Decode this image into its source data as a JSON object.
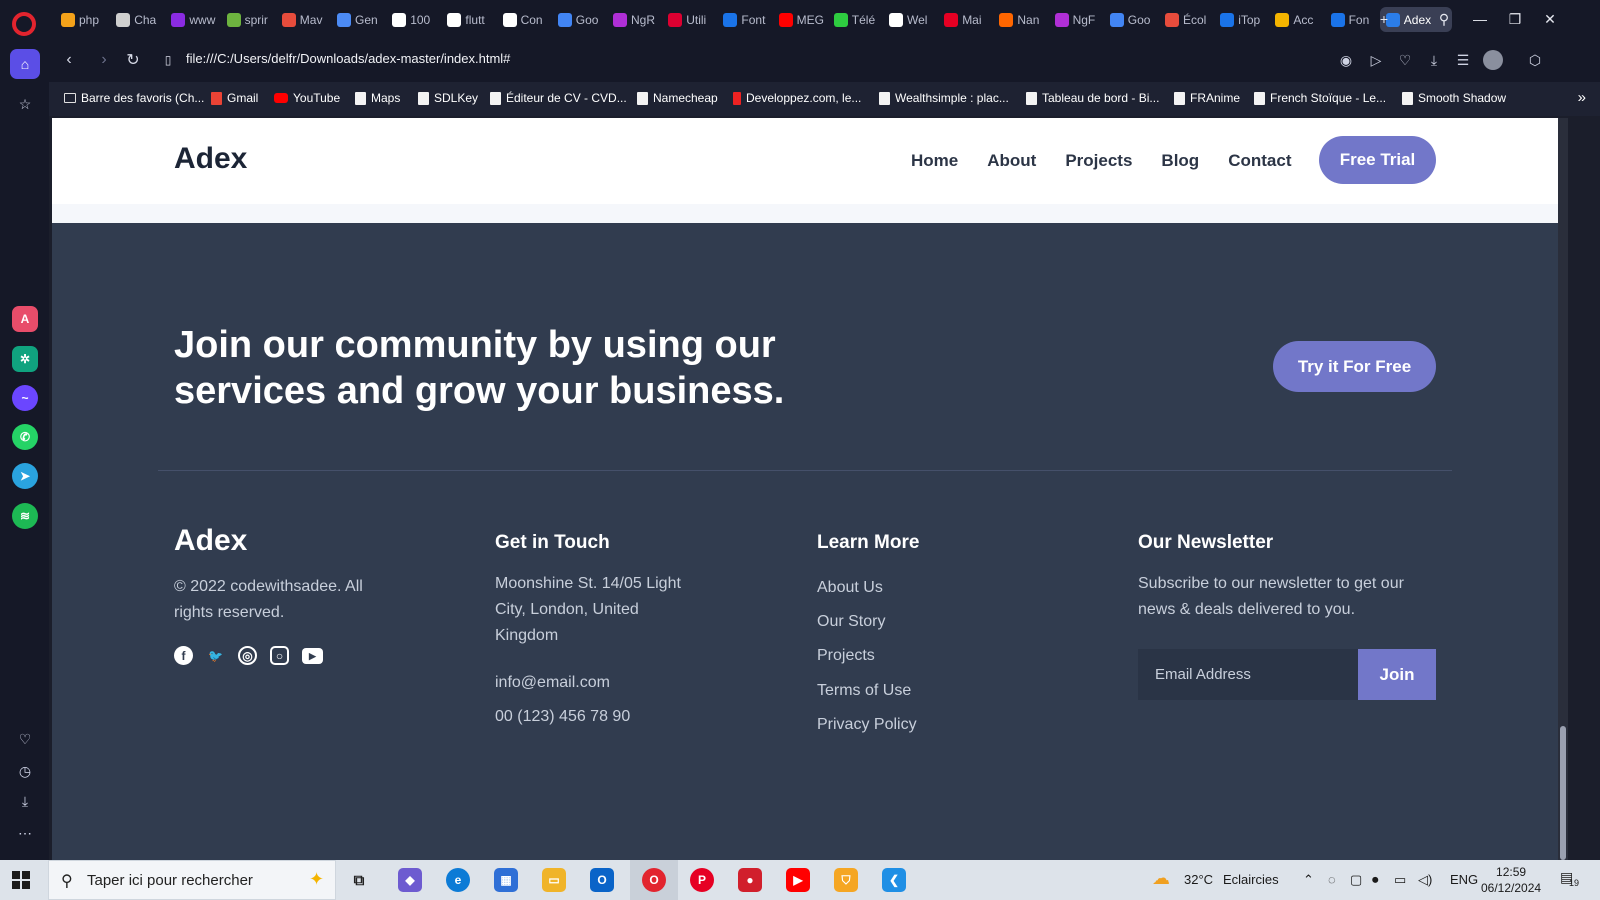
{
  "browser": {
    "tabs": [
      {
        "label": "php",
        "color": "#f4a21a"
      },
      {
        "label": "Cha",
        "color": "#cfcfcf"
      },
      {
        "label": "www",
        "color": "#8a2be2"
      },
      {
        "label": "sprir",
        "color": "#6db33f"
      },
      {
        "label": "Mav",
        "color": "#e74c3c"
      },
      {
        "label": "Gen",
        "color": "#4c8bf5"
      },
      {
        "label": "100",
        "color": "#ffffff"
      },
      {
        "label": "flutt",
        "color": "#ffffff"
      },
      {
        "label": "Con",
        "color": "#ffffff"
      },
      {
        "label": "Goo",
        "color": "#4285f4"
      },
      {
        "label": "NgR",
        "color": "#b02fd6"
      },
      {
        "label": "Utili",
        "color": "#dd0031"
      },
      {
        "label": "Font",
        "color": "#1a73e8"
      },
      {
        "label": "MEG",
        "color": "#ff0000"
      },
      {
        "label": "Télé",
        "color": "#2ecc40"
      },
      {
        "label": "Wel",
        "color": "#ffffff"
      },
      {
        "label": "Mai",
        "color": "#e60023"
      },
      {
        "label": "Nan",
        "color": "#ff6600"
      },
      {
        "label": "NgF",
        "color": "#b02fd6"
      },
      {
        "label": "Goo",
        "color": "#4285f4"
      },
      {
        "label": "Écol",
        "color": "#e74c3c"
      },
      {
        "label": "iTop",
        "color": "#1a73e8"
      },
      {
        "label": "Acc",
        "color": "#f4b400"
      },
      {
        "label": "Fon",
        "color": "#1a73e8"
      },
      {
        "label": "Adex",
        "color": "#2b7de9"
      }
    ],
    "url": "file:///C:/Users/delfr/Downloads/adex-master/index.html#",
    "bookmarks": [
      {
        "label": "Barre des favoris (Ch...",
        "icon": "folder-icon"
      },
      {
        "label": "Gmail",
        "icon": "gmail-icon"
      },
      {
        "label": "YouTube",
        "icon": "youtube-icon"
      },
      {
        "label": "Maps",
        "icon": "page-icon"
      },
      {
        "label": "SDLKey",
        "icon": "page-icon"
      },
      {
        "label": "Éditeur de CV - CVD...",
        "icon": "page-icon"
      },
      {
        "label": "Namecheap",
        "icon": "page-icon"
      },
      {
        "label": "Developpez.com, le...",
        "icon": "developpez-icon"
      },
      {
        "label": "Wealthsimple : plac...",
        "icon": "page-icon"
      },
      {
        "label": "Tableau de bord - Bi...",
        "icon": "page-icon"
      },
      {
        "label": "FRAnime",
        "icon": "page-icon"
      },
      {
        "label": "French Stoïque - Le...",
        "icon": "page-icon"
      },
      {
        "label": "Smooth Shadow",
        "icon": "page-icon"
      }
    ]
  },
  "site": {
    "brand": "Adex",
    "nav": [
      "Home",
      "About",
      "Projects",
      "Blog",
      "Contact"
    ],
    "free_trial": "Free Trial",
    "cta": {
      "heading": "Join our community by using our services and grow your business.",
      "button": "Try it For Free"
    },
    "footer": {
      "brand": "Adex",
      "copyright": "© 2022 codewithsadee. All rights reserved.",
      "socials": [
        "facebook-icon",
        "twitter-icon",
        "dribbble-icon",
        "instagram-icon",
        "youtube-icon"
      ],
      "contact_title": "Get in Touch",
      "address": "Moonshine St. 14/05 Light City, London, United Kingdom",
      "email": "info@email.com",
      "phone": "00 (123) 456 78 90",
      "learn_title": "Learn More",
      "learn_links": [
        "About Us",
        "Our Story",
        "Projects",
        "Terms of Use",
        "Privacy Policy"
      ],
      "newsletter_title": "Our Newsletter",
      "newsletter_text": "Subscribe to our newsletter to get our news & deals delivered to you.",
      "email_placeholder": "Email Address",
      "join": "Join"
    },
    "colors": {
      "accent": "#7277c9",
      "footer_bg": "#313c4f",
      "header_bg": "#ffffff"
    }
  },
  "taskbar": {
    "search_placeholder": "Taper ici pour rechercher",
    "weather_temp": "32°C",
    "weather_text": "Eclaircies",
    "language": "ENG",
    "time": "12:59",
    "date": "06/12/2024",
    "notifications": "19"
  }
}
